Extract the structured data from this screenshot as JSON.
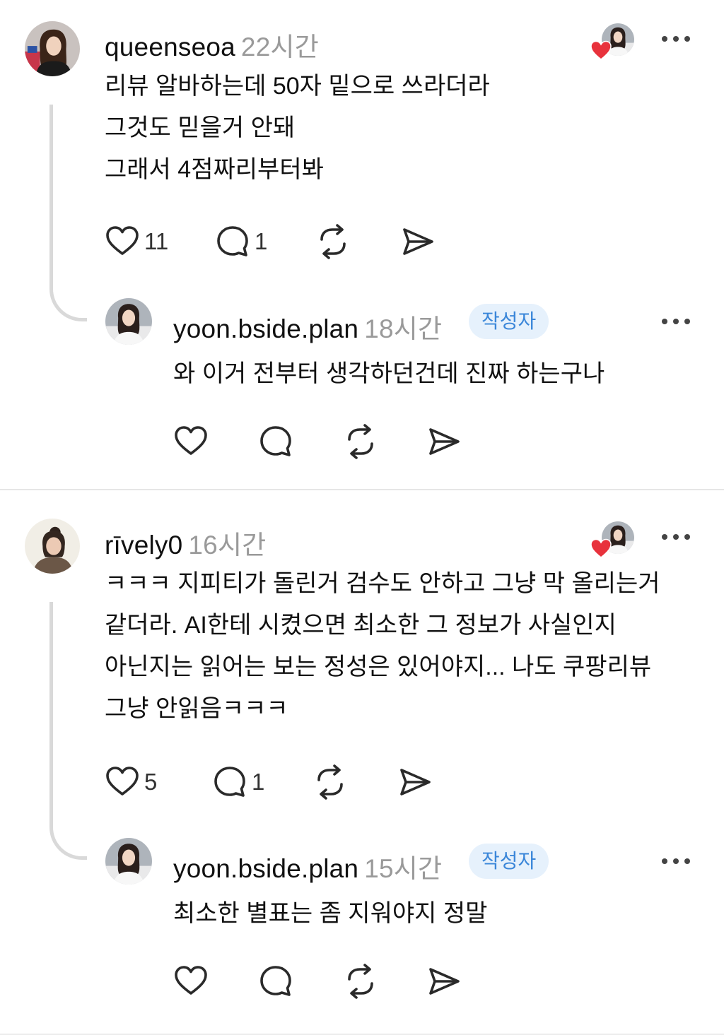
{
  "threads": [
    {
      "comment": {
        "username": "queenseoa",
        "time": "22시간",
        "lines": [
          "리뷰 알바하는데 50자 밑으로 쓰라더라",
          "그것도 믿을거 안돼",
          "그래서 4점짜리부터봐"
        ],
        "likes": "11",
        "replies": "1",
        "liked_by_author": true
      },
      "reply": {
        "username": "yoon.bside.plan",
        "time": "18시간",
        "badge": "작성자",
        "lines": [
          "와 이거 전부터 생각하던건데 진짜 하는구나"
        ]
      }
    },
    {
      "comment": {
        "username": "rīvely0",
        "time": "16시간",
        "lines": [
          "ㅋㅋㅋ 지피티가 돌린거 검수도 안하고 그냥 막 올리는거",
          "같더라.  AI한테 시켰으면 최소한 그 정보가 사실인지",
          "아닌지는 읽어는 보는 정성은 있어야지... 나도 쿠팡리뷰",
          "그냥 안읽음ㅋㅋㅋ"
        ],
        "likes": "5",
        "replies": "1",
        "liked_by_author": true
      },
      "reply": {
        "username": "yoon.bside.plan",
        "time": "15시간",
        "badge": "작성자",
        "lines": [
          "최소한 별표는 좀 지워야지 정말"
        ]
      }
    }
  ],
  "icons": {
    "like": "heart-icon",
    "reply": "comment-bubble-icon",
    "repost": "repost-icon",
    "share": "send-icon",
    "more": "more-dots-icon"
  },
  "colors": {
    "badge_bg": "#e6f1fc",
    "badge_text": "#3a86d9",
    "heart_red": "#e8323c",
    "time_gray": "#9a9a9a",
    "connector": "#d9d9d9"
  }
}
